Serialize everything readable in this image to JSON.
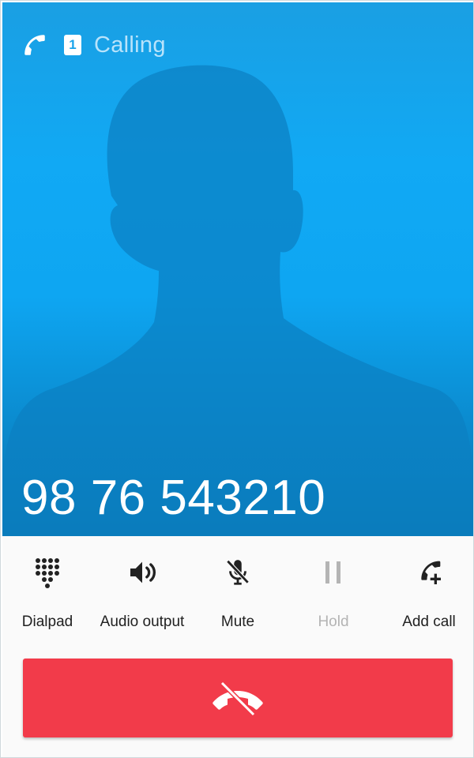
{
  "status": {
    "call_state": "Calling",
    "sim_slot": "1"
  },
  "caller": {
    "number": "98 76 543210"
  },
  "actions": [
    {
      "label": "Dialpad",
      "icon": "dialpad-icon",
      "enabled": true
    },
    {
      "label": "Audio output",
      "icon": "speaker-icon",
      "enabled": true
    },
    {
      "label": "Mute",
      "icon": "mic-off-icon",
      "enabled": true
    },
    {
      "label": "Hold",
      "icon": "pause-icon",
      "enabled": false
    },
    {
      "label": "Add call",
      "icon": "add-call-icon",
      "enabled": true
    }
  ],
  "end_call": {
    "icon": "call-end-icon"
  },
  "colors": {
    "header_blue": "#11a9f4",
    "silhouette": "#0b7fc2",
    "end_call_red": "#f23b4a",
    "disabled_text": "#b4b4b4"
  }
}
